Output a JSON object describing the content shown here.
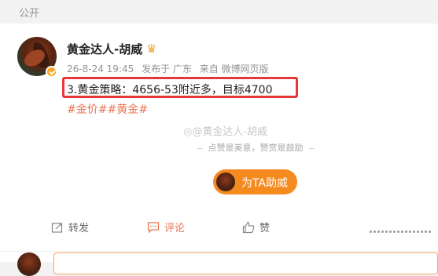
{
  "visibility": {
    "label": "公开"
  },
  "post": {
    "author": "黄金达人-胡威",
    "timestamp": "26-8-24 19:45",
    "location": "发布于 广东",
    "source": "来自 微博网页版",
    "text": "3.黄金策略：4656-53附近多，目标4700",
    "hashtags": [
      "#金价#",
      "#黄金#"
    ]
  },
  "reward": {
    "watermark": "@黄金达人-胡威",
    "note": "点赞是美意，赞赏是鼓励",
    "boost_label": "为TA助威"
  },
  "actions": {
    "repost": "转发",
    "comment": "评论",
    "like": "赞"
  },
  "colors": {
    "accent": "#eb7350",
    "highlight_box": "#e5383b",
    "boost_button": "#f58a1f",
    "verify_badge": "#f7a623"
  },
  "icons": {
    "crown": "crown-icon",
    "verify": "verified-badge-icon",
    "repost": "repost-icon",
    "comment": "comment-icon",
    "like": "thumbs-up-icon",
    "more": "more-dots-icon"
  }
}
